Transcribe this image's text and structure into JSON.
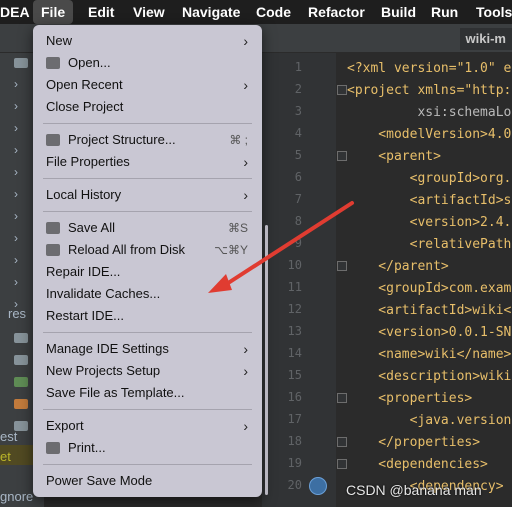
{
  "menubar": {
    "app_fragment": "DEA",
    "items": [
      "File",
      "Edit",
      "View",
      "Navigate",
      "Code",
      "Refactor",
      "Build",
      "Run",
      "Tools"
    ]
  },
  "titlebar": {
    "tab_label": "wiki-m"
  },
  "project_panel": {
    "rows": [
      {
        "kind": "chevron"
      },
      {
        "kind": "chevron"
      },
      {
        "kind": "chevron"
      },
      {
        "kind": "chevron"
      },
      {
        "kind": "chevron"
      },
      {
        "kind": "chevron"
      },
      {
        "kind": "chevron"
      },
      {
        "kind": "chevron"
      },
      {
        "kind": "chevron"
      },
      {
        "kind": "chevron"
      },
      {
        "kind": "chevron"
      },
      {
        "kind": "chevron"
      },
      {
        "kind": "chevron"
      }
    ],
    "text_res": "res",
    "text_est": "est",
    "text_et": "et",
    "text_gnore": "gnore"
  },
  "file_menu": {
    "items": [
      {
        "label": "New",
        "submenu": true,
        "icon": null,
        "shortcut": ""
      },
      {
        "label": "Open...",
        "submenu": false,
        "icon": "folder-icon",
        "shortcut": ""
      },
      {
        "label": "Open Recent",
        "submenu": true,
        "icon": null,
        "shortcut": ""
      },
      {
        "label": "Close Project",
        "submenu": false,
        "icon": null,
        "shortcut": ""
      },
      {
        "label": "Project Structure...",
        "submenu": false,
        "icon": "project-structure-icon",
        "shortcut": "⌘ ;"
      },
      {
        "label": "File Properties",
        "submenu": true,
        "icon": null,
        "shortcut": ""
      },
      {
        "label": "Local History",
        "submenu": true,
        "icon": null,
        "shortcut": ""
      },
      {
        "label": "Save All",
        "submenu": false,
        "icon": "save-icon",
        "shortcut": "⌘S"
      },
      {
        "label": "Reload All from Disk",
        "submenu": false,
        "icon": "reload-icon",
        "shortcut": "⌥⌘Y"
      },
      {
        "label": "Repair IDE...",
        "submenu": false,
        "icon": null,
        "shortcut": ""
      },
      {
        "label": "Invalidate Caches...",
        "submenu": false,
        "icon": null,
        "shortcut": ""
      },
      {
        "label": "Restart IDE...",
        "submenu": false,
        "icon": null,
        "shortcut": ""
      },
      {
        "label": "Manage IDE Settings",
        "submenu": true,
        "icon": null,
        "shortcut": ""
      },
      {
        "label": "New Projects Setup",
        "submenu": true,
        "icon": null,
        "shortcut": ""
      },
      {
        "label": "Save File as Template...",
        "submenu": false,
        "icon": null,
        "shortcut": ""
      },
      {
        "label": "Export",
        "submenu": true,
        "icon": null,
        "shortcut": ""
      },
      {
        "label": "Print...",
        "submenu": false,
        "icon": "printer-icon",
        "shortcut": ""
      },
      {
        "label": "Power Save Mode",
        "submenu": false,
        "icon": null,
        "shortcut": ""
      }
    ]
  },
  "editor": {
    "line_numbers": [
      "1",
      "2",
      "3",
      "4",
      "5",
      "6",
      "7",
      "8",
      "9",
      "10",
      "11",
      "12",
      "13",
      "14",
      "15",
      "16",
      "17",
      "18",
      "19",
      "20"
    ],
    "lines": [
      "<?xml version=\"1.0\" e",
      "<project xmlns=\"http:",
      "         xsi:schemaLoc",
      "    <modelVersion>4.0",
      "    <parent>",
      "        <groupId>org.",
      "        <artifactId>s",
      "        <version>2.4.",
      "        <relativePath",
      "    </parent>",
      "    <groupId>com.exam",
      "    <artifactId>wiki<",
      "    <version>0.0.1-SN",
      "    <name>wiki</name>",
      "    <description>wiki",
      "    <properties>",
      "        <java.version",
      "    </properties>",
      "    <dependencies>",
      "        <dependency>"
    ]
  },
  "watermark": "CSDN @banana man",
  "annotation_arrow_color": "#e03c31"
}
